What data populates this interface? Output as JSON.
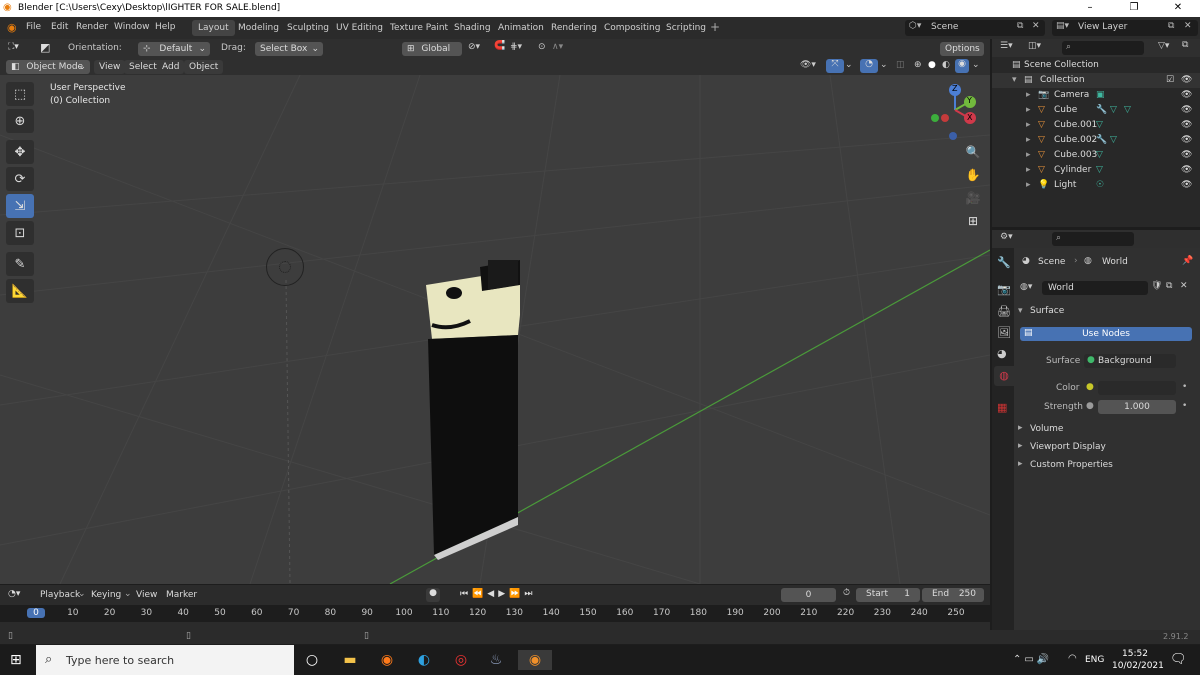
{
  "app": {
    "title": "Blender [C:\\Users\\Cexy\\Desktop\\lIGHTER FOR SALE.blend]"
  },
  "menu": [
    "File",
    "Edit",
    "Render",
    "Window",
    "Help"
  ],
  "workspaces": [
    "Layout",
    "Modeling",
    "Sculpting",
    "UV Editing",
    "Texture Paint",
    "Shading",
    "Animation",
    "Rendering",
    "Compositing",
    "Scripting"
  ],
  "scene_label": "Scene",
  "viewlayer_label": "View Layer",
  "toolhdr": {
    "orientation_label": "Orientation:",
    "orientation_value": "Default",
    "drag_label": "Drag:",
    "drag_value": "Select Box",
    "transform": "Global",
    "options": "Options"
  },
  "hdr2": {
    "mode": "Object Mode",
    "items": [
      "View",
      "Select",
      "Add",
      "Object"
    ]
  },
  "viewport": {
    "line1": "User Perspective",
    "line2": "(0) Collection",
    "gizmo_labels": [
      "Z",
      "Y",
      "X"
    ]
  },
  "outliner": {
    "root": "Scene Collection",
    "collection": "Collection",
    "items": [
      "Camera",
      "Cube",
      "Cube.001",
      "Cube.002",
      "Cube.003",
      "Cylinder",
      "Light"
    ]
  },
  "properties": {
    "breadcrumb_scene": "Scene",
    "breadcrumb_world": "World",
    "world_name": "World",
    "surface_panel": "Surface",
    "use_nodes": "Use Nodes",
    "surface_label": "Surface",
    "surface_value": "Background",
    "color_label": "Color",
    "strength_label": "Strength",
    "strength_value": "1.000",
    "panels": [
      "Volume",
      "Viewport Display",
      "Custom Properties"
    ]
  },
  "timeline": {
    "menus": [
      "Playback",
      "Keying",
      "View",
      "Marker"
    ],
    "current_frame": "0",
    "start_label": "Start",
    "start_value": "1",
    "end_label": "End",
    "end_value": "250",
    "ruler": [
      "0",
      "10",
      "20",
      "30",
      "40",
      "50",
      "60",
      "70",
      "80",
      "90",
      "100",
      "110",
      "120",
      "130",
      "140",
      "150",
      "160",
      "170",
      "180",
      "190",
      "200",
      "210",
      "220",
      "230",
      "240",
      "250"
    ]
  },
  "status": {
    "version": "2.91.2"
  },
  "taskbar": {
    "search_placeholder": "Type here to search",
    "lang": "ENG",
    "time": "15:52",
    "date": "10/02/2021"
  },
  "colors": {
    "accent": "#4772b3",
    "active_tool": "#4772b3",
    "grid_x": "#7a2a2a",
    "grid_y": "#4a9a3a"
  }
}
